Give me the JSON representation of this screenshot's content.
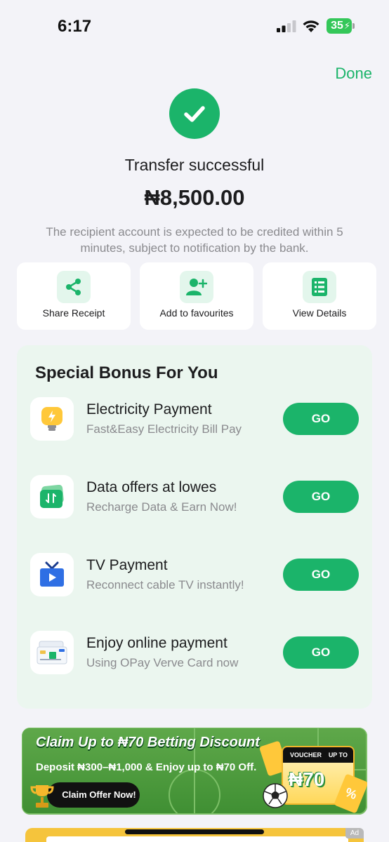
{
  "status_bar": {
    "time": "6:17",
    "battery": "35"
  },
  "header": {
    "done_label": "Done"
  },
  "result": {
    "title": "Transfer successful",
    "amount": "₦8,500.00",
    "note": "The recipient account is expected to be credited within 5 minutes, subject to notification by the bank."
  },
  "actions": [
    {
      "label": "Share Receipt",
      "icon": "share-icon"
    },
    {
      "label": "Add to favourites",
      "icon": "add-user-icon"
    },
    {
      "label": "View Details",
      "icon": "details-list-icon"
    }
  ],
  "bonus": {
    "title": "Special Bonus For You",
    "go_label": "GO",
    "items": [
      {
        "name": "Electricity Payment",
        "desc": "Fast&Easy Electricity Bill Pay",
        "icon": "lightbulb-icon"
      },
      {
        "name": "Data offers at lowes",
        "desc": "Recharge Data & Earn Now!",
        "icon": "data-card-icon"
      },
      {
        "name": "TV Payment",
        "desc": "Reconnect cable TV instantly!",
        "icon": "tv-icon"
      },
      {
        "name": "Enjoy online payment",
        "desc": "Using OPay Verve Card now",
        "icon": "card-icon"
      }
    ]
  },
  "banner": {
    "title": "Claim Up to ₦70 Betting Discount",
    "subtitle": "Deposit ₦300–₦1,000 & Enjoy up to ₦70 Off.",
    "cta": "Claim Offer Now!",
    "voucher_label": "VOUCHER",
    "voucher_upto": "UP TO",
    "voucher_amount": "₦70",
    "coupon_symbol": "%"
  },
  "ad_tag": "Ad",
  "colors": {
    "accent": "#1bb46a",
    "background": "#f3f3f8",
    "bonus_panel": "#ebf6ef"
  }
}
